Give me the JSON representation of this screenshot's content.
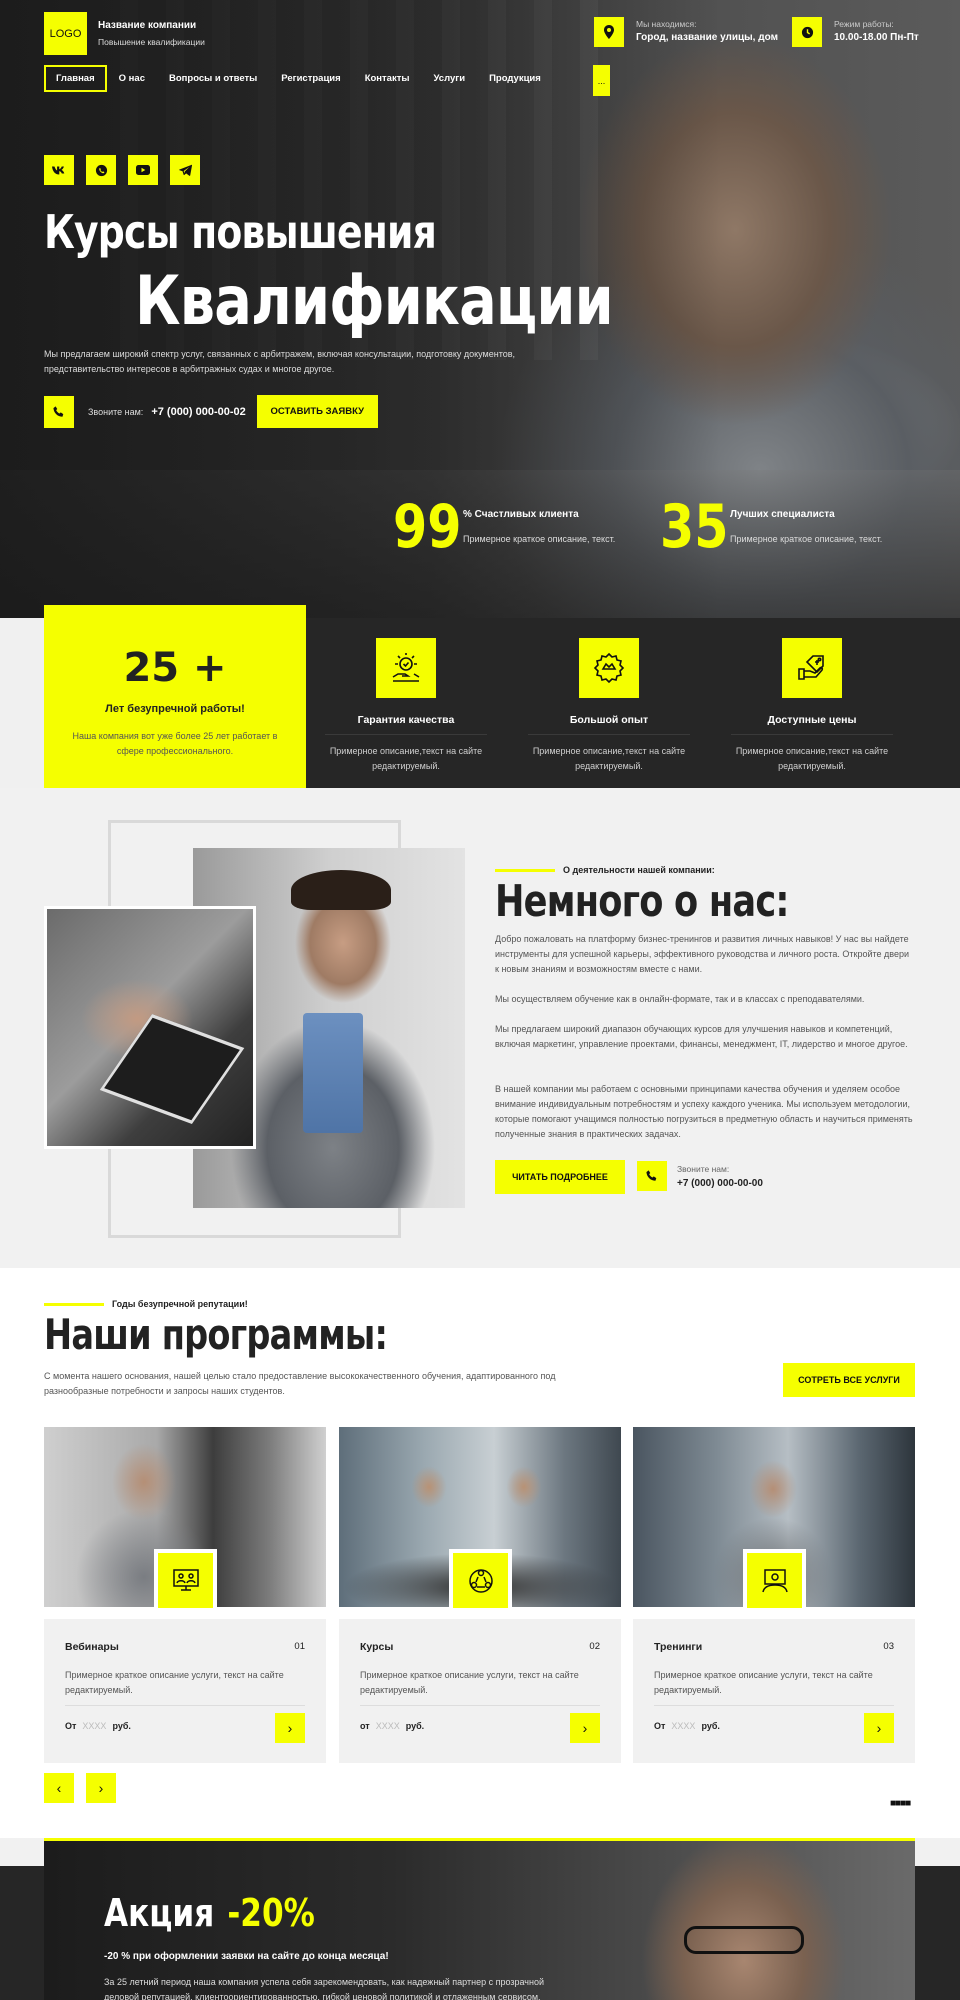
{
  "header": {
    "logo": "LOGO",
    "company_name": "Название компании",
    "company_sub": "Повышение квалификации",
    "location_label": "Мы находимся:",
    "location_value": "Город, название улицы, дом",
    "hours_label": "Режим работы:",
    "hours_value": "10.00-18.00 Пн-Пт",
    "nav": [
      "Главная",
      "О нас",
      "Вопросы и ответы",
      "Регистрация",
      "Контакты",
      "Услуги",
      "Продукция"
    ],
    "nav_more": "...",
    "socials": [
      "vk",
      "whatsapp",
      "youtube",
      "telegram"
    ]
  },
  "hero": {
    "title_line1": "Курсы повышения",
    "title_line2": "Квалификации",
    "description": "Мы предлагаем широкий спектр услуг, связанных с арбитражем, включая консультации, подготовку документов, представительство интересов в арбитражных судах и многое другое.",
    "call_label": "Звоните нам:",
    "phone": "+7 (000) 000-00-02",
    "cta": "ОСТАВИТЬ ЗАЯВКУ",
    "stats": [
      {
        "number": "99",
        "title": "% Счастливых клиента",
        "desc": "Примерное краткое описание, текст."
      },
      {
        "number": "35",
        "title": "Лучших специалиста",
        "desc": "Примерное краткое описание, текст."
      }
    ]
  },
  "features": {
    "years_number": "25 +",
    "years_title": "Лет безупречной работы!",
    "years_desc": "Наша компания вот уже более 25 лет работает в сфере профессионального.",
    "items": [
      {
        "title": "Гарантия качества",
        "desc": "Примерное описание,текст на сайте редактируемый.",
        "icon": "quality-icon"
      },
      {
        "title": "Большой опыт",
        "desc": "Примерное описание,текст на сайте редактируемый.",
        "icon": "experience-icon"
      },
      {
        "title": "Доступные цены",
        "desc": "Примерное описание,текст на сайте редактируемый.",
        "icon": "price-icon"
      }
    ]
  },
  "about": {
    "eyebrow": "О деятельности нашей компании:",
    "title": "Немного о нас:",
    "paragraphs": [
      "Добро пожаловать на платформу бизнес-тренингов и развития личных навыков! У нас вы найдете инструменты для успешной карьеры, эффективного руководства и личного роста. Откройте двери к новым знаниям и возможностям вместе с нами.",
      "Мы осуществляем обучение как в онлайн-формате, так и в классах с преподавателями.",
      "Мы предлагаем широкий диапазон обучающих курсов для улучшения навыков и компетенций, включая маркетинг, управление проектами, финансы, менеджмент, IT, лидерство и многое другое.",
      "В нашей компании мы работаем с основными принципами качества обучения и уделяем особое внимание индивидуальным потребностям и успеху каждого ученика. Мы используем методологии, которые помогают учащимся полностью погрузиться в предметную область и научиться применять полученные знания в практических задачах."
    ],
    "read_more": "ЧИТАТЬ ПОДРОБНЕЕ",
    "call_label": "Звоните нам:",
    "phone": "+7 (000) 000-00-00"
  },
  "programs": {
    "eyebrow": "Годы безупречной репутации!",
    "title": "Наши программы:",
    "description": "С момента нашего основания, нашей целью стало предоставление высококачественного обучения, адаптированного под разнообразные потребности и запросы наших студентов.",
    "all_button": "СОТРЕТЬ ВСЕ УСЛУГИ",
    "cards": [
      {
        "title": "Вебинары",
        "num": "01",
        "desc": "Примерное краткое описание услуги, текст на сайте редактируемый.",
        "price_prefix": "От",
        "price_placeholder": "XXXX",
        "price_suffix": "руб."
      },
      {
        "title": "Курсы",
        "num": "02",
        "desc": "Примерное краткое описание услуги, текст на сайте редактируемый.",
        "price_prefix": "от",
        "price_placeholder": "XXXX",
        "price_suffix": "руб."
      },
      {
        "title": "Тренинги",
        "num": "03",
        "desc": "Примерное краткое описание услуги, текст на сайте редактируемый.",
        "price_prefix": "От",
        "price_placeholder": "XXXX",
        "price_suffix": "руб."
      }
    ],
    "prev": "‹",
    "next": "›",
    "dots": "■■■■"
  },
  "promo": {
    "title": "Акция",
    "discount": "-20%",
    "subtitle": "-20 % при оформлении заявки на сайте до конца месяца!",
    "description": "За 25 летний период наша компания успела себя зарекомендовать, как надежный партнер с прозрачной деловой репутацией, клиентоориентированностью, гибкой ценовой политикой и отлаженным сервисом."
  },
  "colors": {
    "accent": "#f5ff00",
    "dark": "#262626",
    "light": "#f1f1f1"
  }
}
